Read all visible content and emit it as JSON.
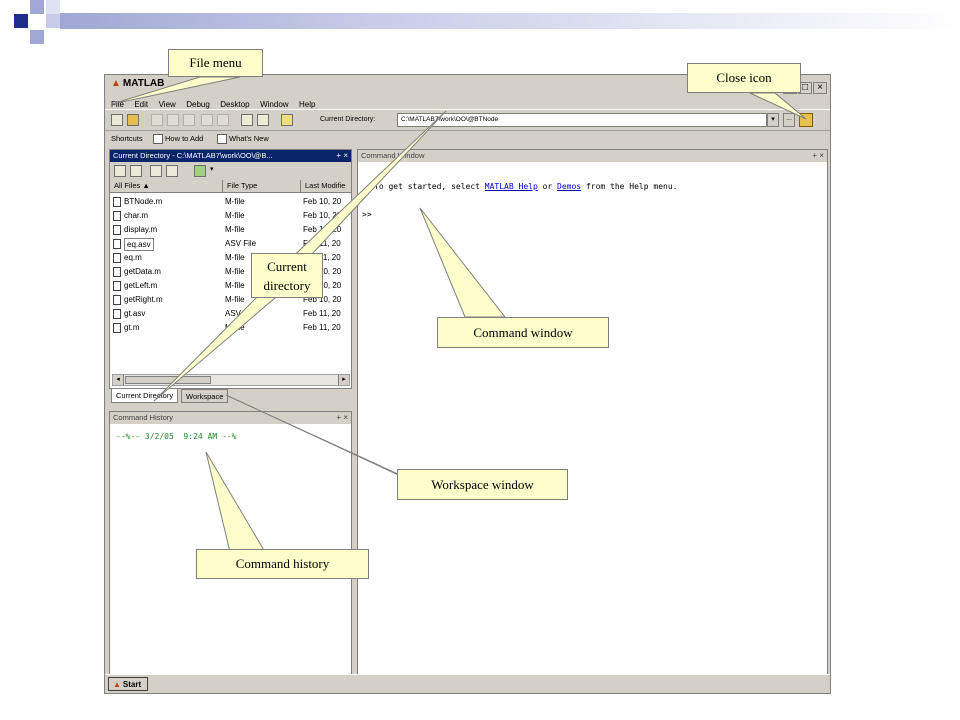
{
  "colors": {
    "slide_accent": "#1f2d8a",
    "title_active": "#0a246a",
    "callout_fill": "#ffffcc",
    "link": "#0000cc",
    "history_green": "#228822"
  },
  "window": {
    "title": "MATLAB",
    "controls": {
      "minimize": "_",
      "maximize": "□",
      "close": "×"
    }
  },
  "menu": [
    "File",
    "Edit",
    "View",
    "Debug",
    "Desktop",
    "Window",
    "Help"
  ],
  "toolbar": {
    "current_directory_label": "Current Directory:",
    "current_directory_value": "C:\\MATLAB7\\work\\OO\\@BTNode",
    "dropdown": "▾",
    "browse": "..."
  },
  "shortcuts": {
    "label": "Shortcuts",
    "items": [
      "How to Add",
      "What's New"
    ]
  },
  "current_directory_pane": {
    "title": "Current Directory - C:\\MATLAB7\\work\\OO\\@B...",
    "controls": "+ ×",
    "columns": [
      "All Files ▲",
      "File Type",
      "Last Modifie"
    ],
    "files": [
      {
        "name": "BTNode.m",
        "type": "M-file",
        "date": "Feb 10, 20"
      },
      {
        "name": "char.m",
        "type": "M-file",
        "date": "Feb 10, 20"
      },
      {
        "name": "display.m",
        "type": "M-file",
        "date": "Feb 10, 20"
      },
      {
        "name": "eq.asv",
        "type": "ASV File",
        "date": "Feb 11, 20"
      },
      {
        "name": "eq.m",
        "type": "M-file",
        "date": "Feb 11, 20"
      },
      {
        "name": "getData.m",
        "type": "M-file",
        "date": "Feb 10, 20"
      },
      {
        "name": "getLeft.m",
        "type": "M-file",
        "date": "Feb 10, 20"
      },
      {
        "name": "getRight.m",
        "type": "M-file",
        "date": "Feb 10, 20"
      },
      {
        "name": "gt.asv",
        "type": "ASV File",
        "date": "Feb 11, 20"
      },
      {
        "name": "gt.m",
        "type": "M-file",
        "date": "Feb 11, 20"
      }
    ],
    "tabs": [
      "Current Directory",
      "Workspace"
    ]
  },
  "command_history": {
    "title": "Command History",
    "controls": "+ ×",
    "entry": "--%-- 3/2/05  9:24 AM --%"
  },
  "command_window": {
    "title": "Command Window",
    "controls": "+ ×",
    "intro_before": "To get started, select ",
    "link1": "MATLAB Help",
    "intro_mid": " or ",
    "link2": "Demos",
    "intro_after": " from the Help menu.",
    "prompt": ">>"
  },
  "statusbar": {
    "start": "Start"
  },
  "callouts": {
    "file_menu": "File menu",
    "close_icon": "Close icon",
    "current_directory_line1": "Current",
    "current_directory_line2": "directory",
    "command_window": "Command window",
    "workspace_window": "Workspace window",
    "command_history": "Command history"
  }
}
